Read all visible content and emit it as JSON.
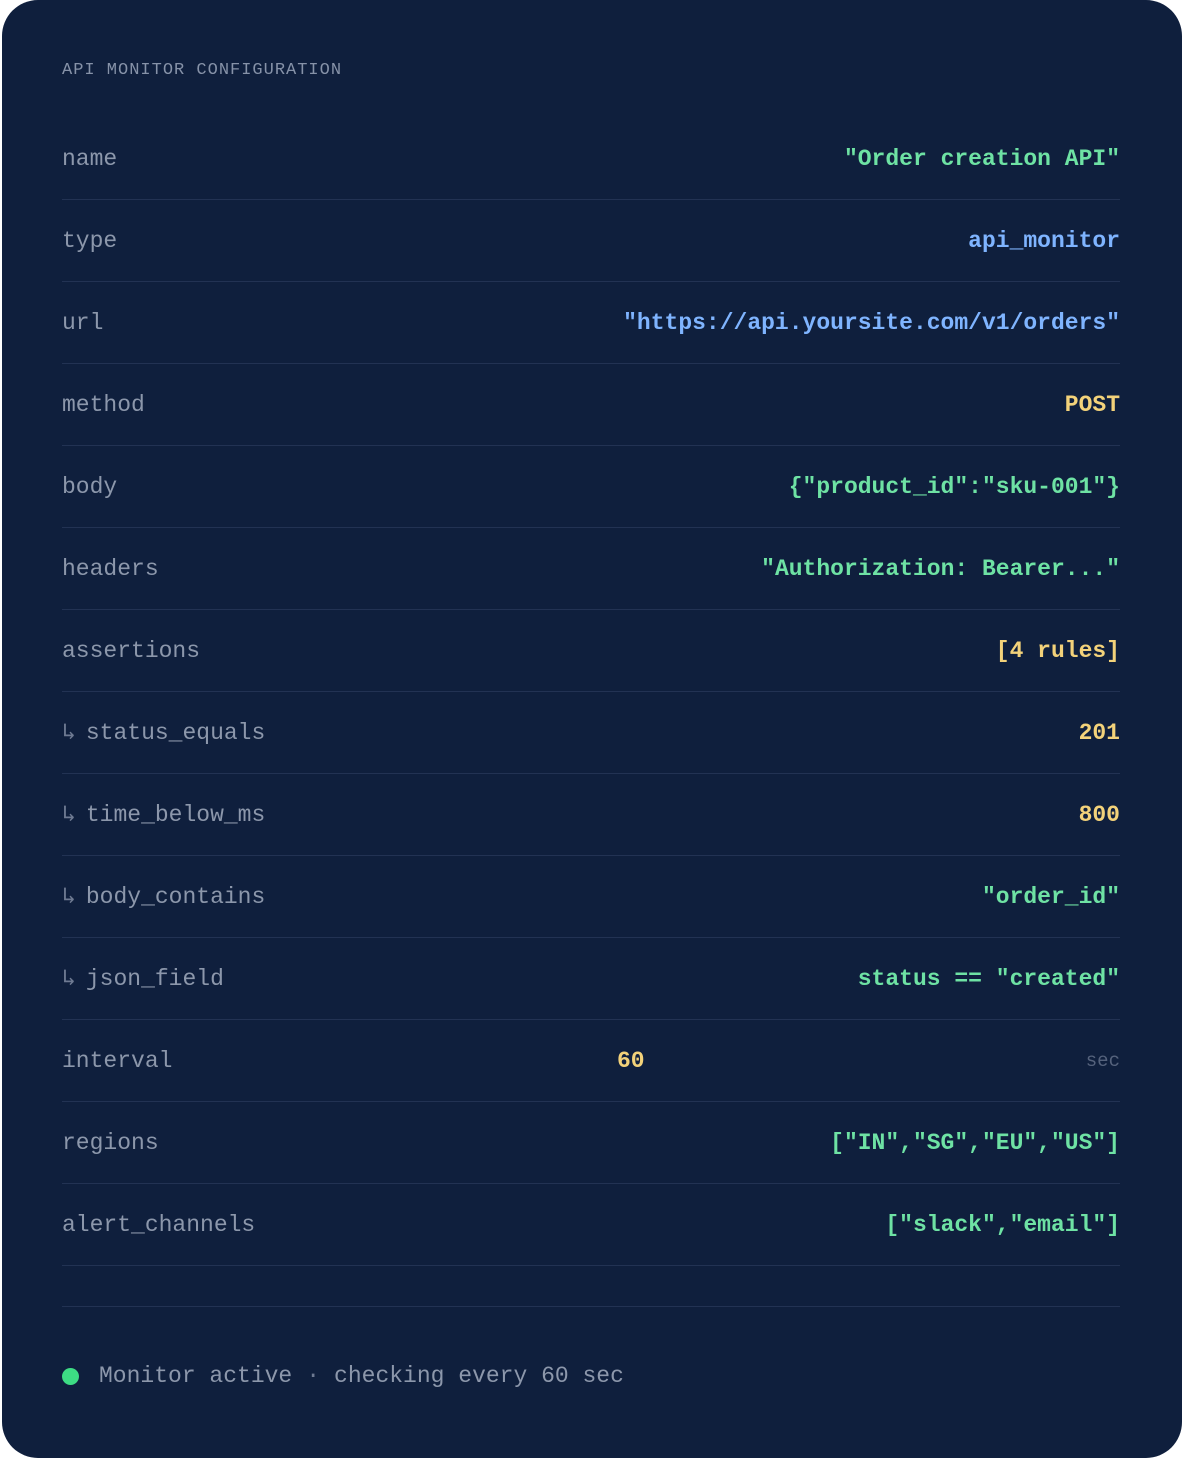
{
  "title": "API MONITOR CONFIGURATION",
  "fields": [
    {
      "key": "name",
      "value": "\"Order creation API\"",
      "color": "#6ee2a4"
    },
    {
      "key": "type",
      "value": "api_monitor",
      "color": "#7fb4ff"
    },
    {
      "key": "url",
      "value": "\"https://api.yoursite.com/v1/orders\"",
      "color": "#7fb4ff"
    },
    {
      "key": "method",
      "value": "POST",
      "color": "#f3d27a"
    },
    {
      "key": "body",
      "value": "{\"product_id\":\"sku-001\"}",
      "color": "#6ee2a4"
    },
    {
      "key": "headers",
      "value": "\"Authorization: Bearer...\"",
      "color": "#6ee2a4"
    },
    {
      "key": "assertions",
      "value": "[4 rules]",
      "color": "#f3d27a"
    },
    {
      "key": "status_equals",
      "value": "201",
      "color": "#f3d27a",
      "sub": true
    },
    {
      "key": "time_below_ms",
      "value": "800",
      "color": "#f3d27a",
      "sub": true
    },
    {
      "key": "body_contains",
      "value": "\"order_id\"",
      "color": "#6ee2a4",
      "sub": true
    },
    {
      "key": "json_field",
      "value": "status == \"created\"",
      "color": "#6ee2a4",
      "sub": true
    }
  ],
  "interval": {
    "key": "interval",
    "value": "60",
    "unit": "sec"
  },
  "fields_after": [
    {
      "key": "regions",
      "value": "[\"IN\",\"SG\",\"EU\",\"US\"]",
      "color": "#6ee2a4"
    },
    {
      "key": "alert_channels",
      "value": "[\"slack\",\"email\"]",
      "color": "#6ee2a4"
    }
  ],
  "sub_arrow": "↳",
  "status": {
    "text": "Monitor active",
    "separator": "·",
    "detail": "checking every 60 sec",
    "dot_color": "#3ddc84"
  }
}
